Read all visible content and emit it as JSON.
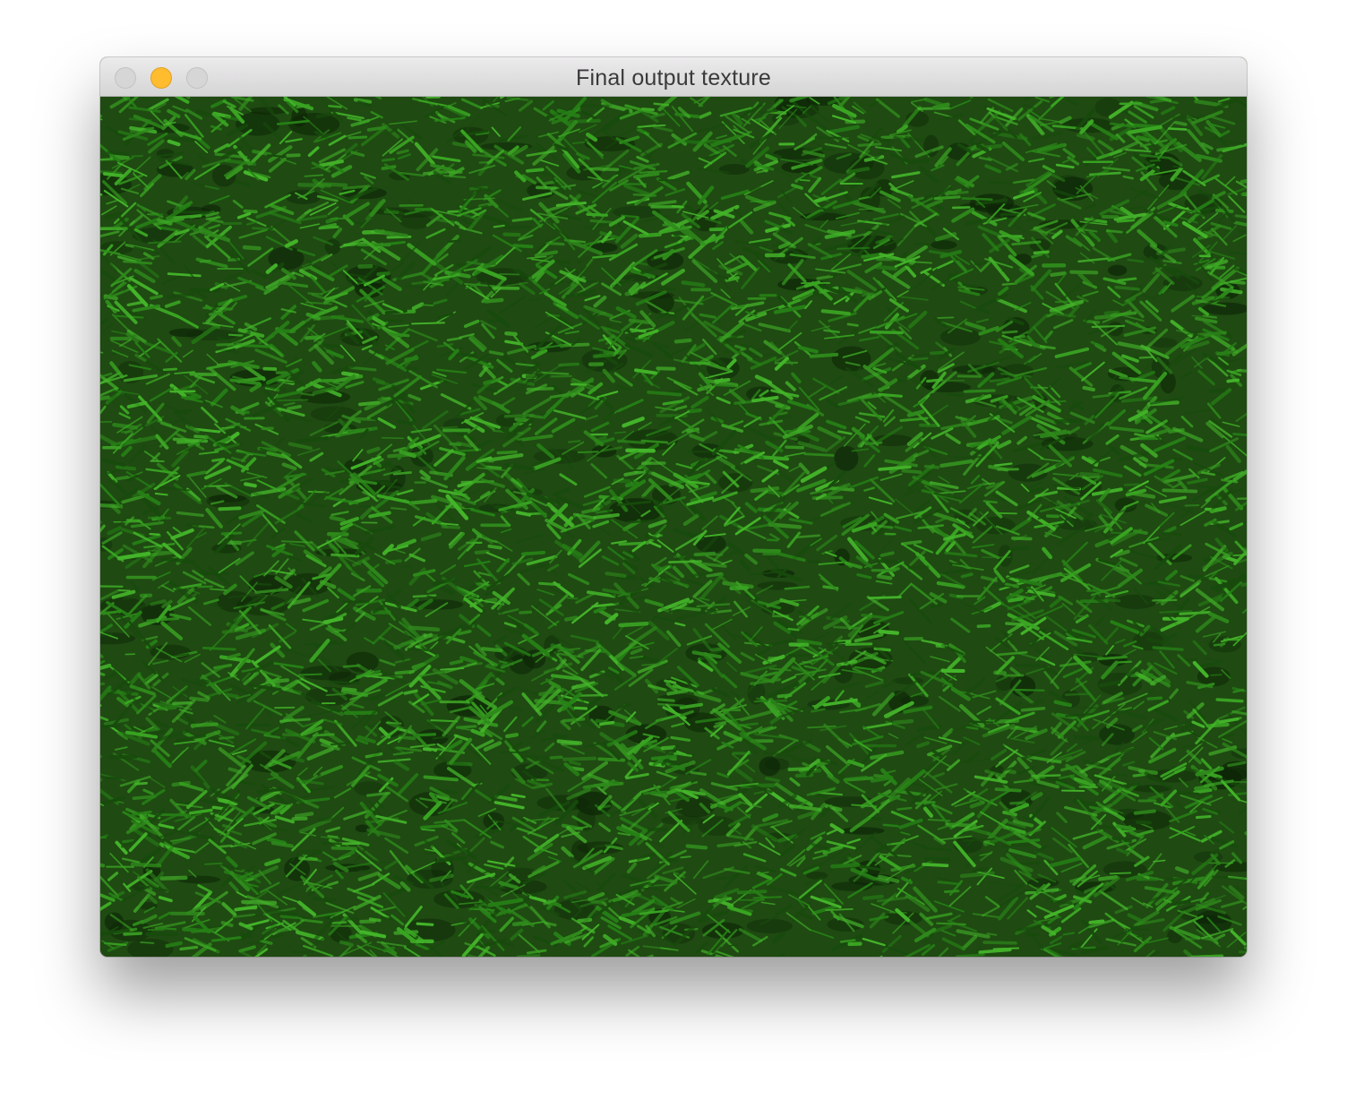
{
  "window": {
    "title": "Final output texture",
    "buttons": {
      "close": "close-icon",
      "minimize": "minimize-icon",
      "zoom": "zoom-icon"
    },
    "accent_colors": {
      "minimize": "#febc2e",
      "inactive": "#d7d6d7"
    }
  },
  "texture": {
    "subject": "grass",
    "base_color": "#1f4a12",
    "blade_colors": [
      "#2f8a1c",
      "#3aa523",
      "#268016",
      "#174a0c",
      "#44b52a"
    ]
  }
}
